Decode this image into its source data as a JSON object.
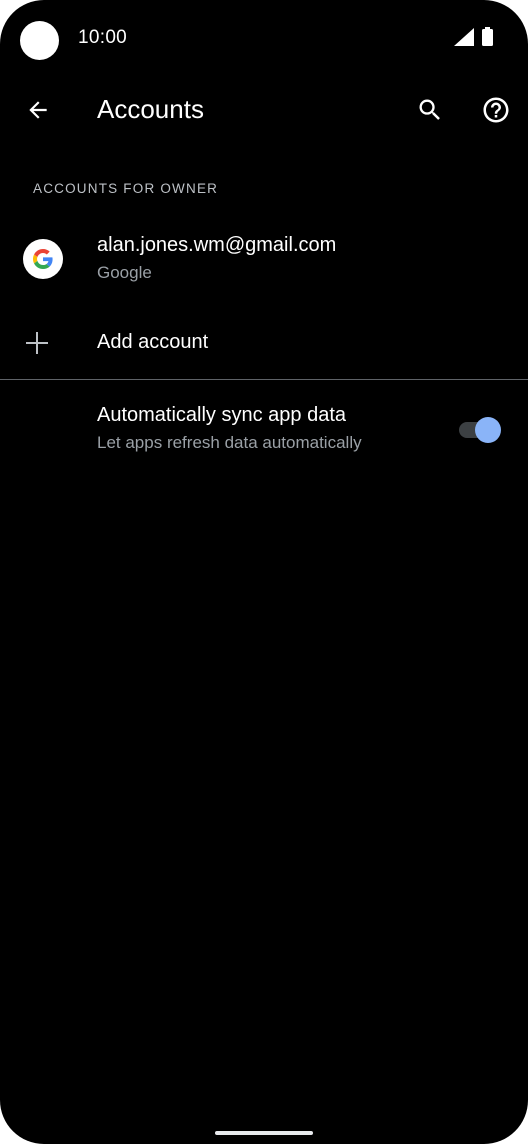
{
  "status_bar": {
    "time": "10:00",
    "icons": [
      "camera-cutout",
      "signal-icon",
      "battery-icon"
    ]
  },
  "app_bar": {
    "title": "Accounts",
    "actions": [
      "back-arrow-icon",
      "search-icon",
      "help-icon"
    ]
  },
  "section": {
    "header": "ACCOUNTS FOR OWNER"
  },
  "account": {
    "email": "alan.jones.wm@gmail.com",
    "type": "Google",
    "icon": "google-logo-icon"
  },
  "add_account": {
    "label": "Add account",
    "icon": "plus-icon"
  },
  "sync": {
    "title": "Automatically sync app data",
    "subtitle": "Let apps refresh data automatically",
    "enabled": true
  },
  "colors": {
    "background": "#000000",
    "accent": "#8ab4f8",
    "text_primary": "#ffffff",
    "text_secondary": "#9aa0a6"
  }
}
